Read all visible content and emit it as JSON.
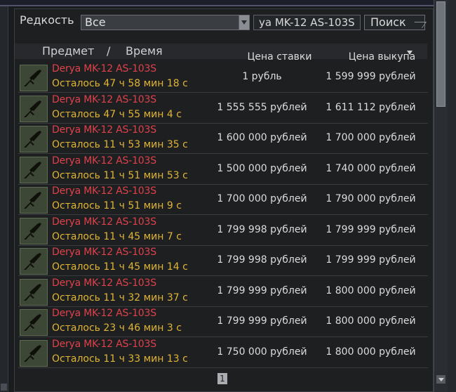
{
  "filter": {
    "rarity_label": "Редкость",
    "rarity_value": "Все",
    "search_value": "ya MK-12 AS-103S",
    "search_button": "Поиск"
  },
  "columns": {
    "item": "Предмет",
    "separator": "/",
    "time": "Время",
    "bid": "Цена ставки",
    "buyout": "Цена выкупа"
  },
  "rows": [
    {
      "name": "Derya MK-12 AS-103S",
      "remaining": "Осталось 47 ч 58 мин 18 с",
      "bid": "1 рубль",
      "buyout": "1 599 999 рублей"
    },
    {
      "name": "Derya MK-12 AS-103S",
      "remaining": "Осталось 47 ч 55 мин 4 с",
      "bid": "1 555 555 рублей",
      "buyout": "1 611 112 рублей"
    },
    {
      "name": "Derya MK-12 AS-103S",
      "remaining": "Осталось 11 ч 53 мин 35 с",
      "bid": "1 600 000 рублей",
      "buyout": "1 700 000 рублей"
    },
    {
      "name": "Derya MK-12 AS-103S",
      "remaining": "Осталось 11 ч 51 мин 53 с",
      "bid": "1 500 000 рублей",
      "buyout": "1 740 000 рублей"
    },
    {
      "name": "Derya MK-12 AS-103S",
      "remaining": "Осталось 11 ч 51 мин 9 с",
      "bid": "1 700 000 рублей",
      "buyout": "1 790 000 рублей"
    },
    {
      "name": "Derya MK-12 AS-103S",
      "remaining": "Осталось 11 ч 45 мин 7 с",
      "bid": "1 799 998 рублей",
      "buyout": "1 799 999 рублей"
    },
    {
      "name": "Derya MK-12 AS-103S",
      "remaining": "Осталось 11 ч 45 мин 14 с",
      "bid": "1 799 998 рублей",
      "buyout": "1 799 999 рублей"
    },
    {
      "name": "Derya MK-12 AS-103S",
      "remaining": "Осталось 11 ч 32 мин 37 с",
      "bid": "1 799 999 рублей",
      "buyout": "1 800 000 рублей"
    },
    {
      "name": "Derya MK-12 AS-103S",
      "remaining": "Осталось 23 ч 46 мин 3 с",
      "bid": "1 799 999 рублей",
      "buyout": "1 800 000 рублей"
    },
    {
      "name": "Derya MK-12 AS-103S",
      "remaining": "Осталось 11 ч 33 мин 13 с",
      "bid": "1 750 000 рублей",
      "buyout": "1 800 000 рублей"
    }
  ],
  "pager": {
    "current": "1"
  },
  "icons": {
    "item_thumb": "rifle-icon",
    "sort": "sort-desc-icon",
    "dropdown": "chevron-down-icon"
  },
  "colors": {
    "item_name": "#e0414b",
    "time_remaining": "#e0b535"
  }
}
